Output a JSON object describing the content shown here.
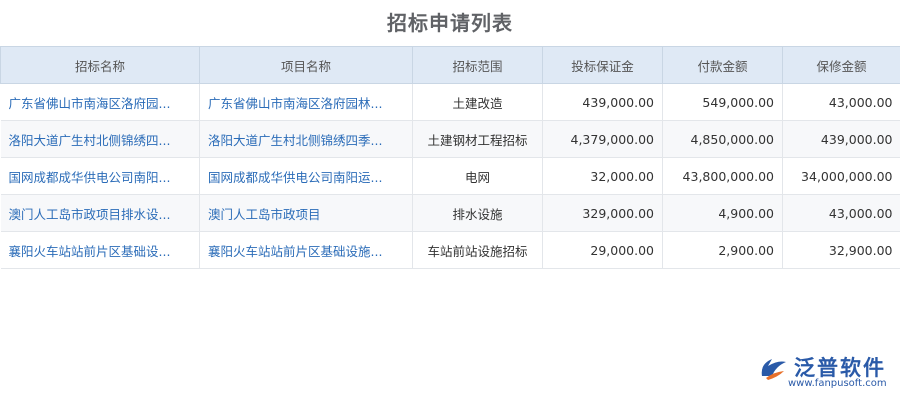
{
  "title": "招标申请列表",
  "columns": [
    "招标名称",
    "项目名称",
    "招标范围",
    "投标保证金",
    "付款金额",
    "保修金额"
  ],
  "rows": [
    {
      "bid_name": "广东省佛山市南海区洛府园...",
      "project_name": "广东省佛山市南海区洛府园林...",
      "scope": "土建改造",
      "deposit": "439,000.00",
      "payment": "549,000.00",
      "warranty": "43,000.00"
    },
    {
      "bid_name": "洛阳大道广生村北侧锦绣四...",
      "project_name": "洛阳大道广生村北侧锦绣四季...",
      "scope": "土建钢材工程招标",
      "deposit": "4,379,000.00",
      "payment": "4,850,000.00",
      "warranty": "439,000.00"
    },
    {
      "bid_name": "国网成都成华供电公司南阳...",
      "project_name": "国网成都成华供电公司南阳运...",
      "scope": "电网",
      "deposit": "32,000.00",
      "payment": "43,800,000.00",
      "warranty": "34,000,000.00"
    },
    {
      "bid_name": "澳门人工岛市政项目排水设...",
      "project_name": "澳门人工岛市政项目",
      "scope": "排水设施",
      "deposit": "329,000.00",
      "payment": "4,900.00",
      "warranty": "43,000.00"
    },
    {
      "bid_name": "襄阳火车站站前片区基础设...",
      "project_name": "襄阳火车站站前片区基础设施...",
      "scope": "车站前站设施招标",
      "deposit": "29,000.00",
      "payment": "2,900.00",
      "warranty": "32,900.00"
    }
  ],
  "logo": {
    "name": "泛普软件",
    "url": "www.fanpusoft.com"
  },
  "colors": {
    "header_bg": "#dfe9f5",
    "link": "#2b6cb8",
    "brand": "#2a5aa8",
    "logo_accent": "#e8702a"
  }
}
